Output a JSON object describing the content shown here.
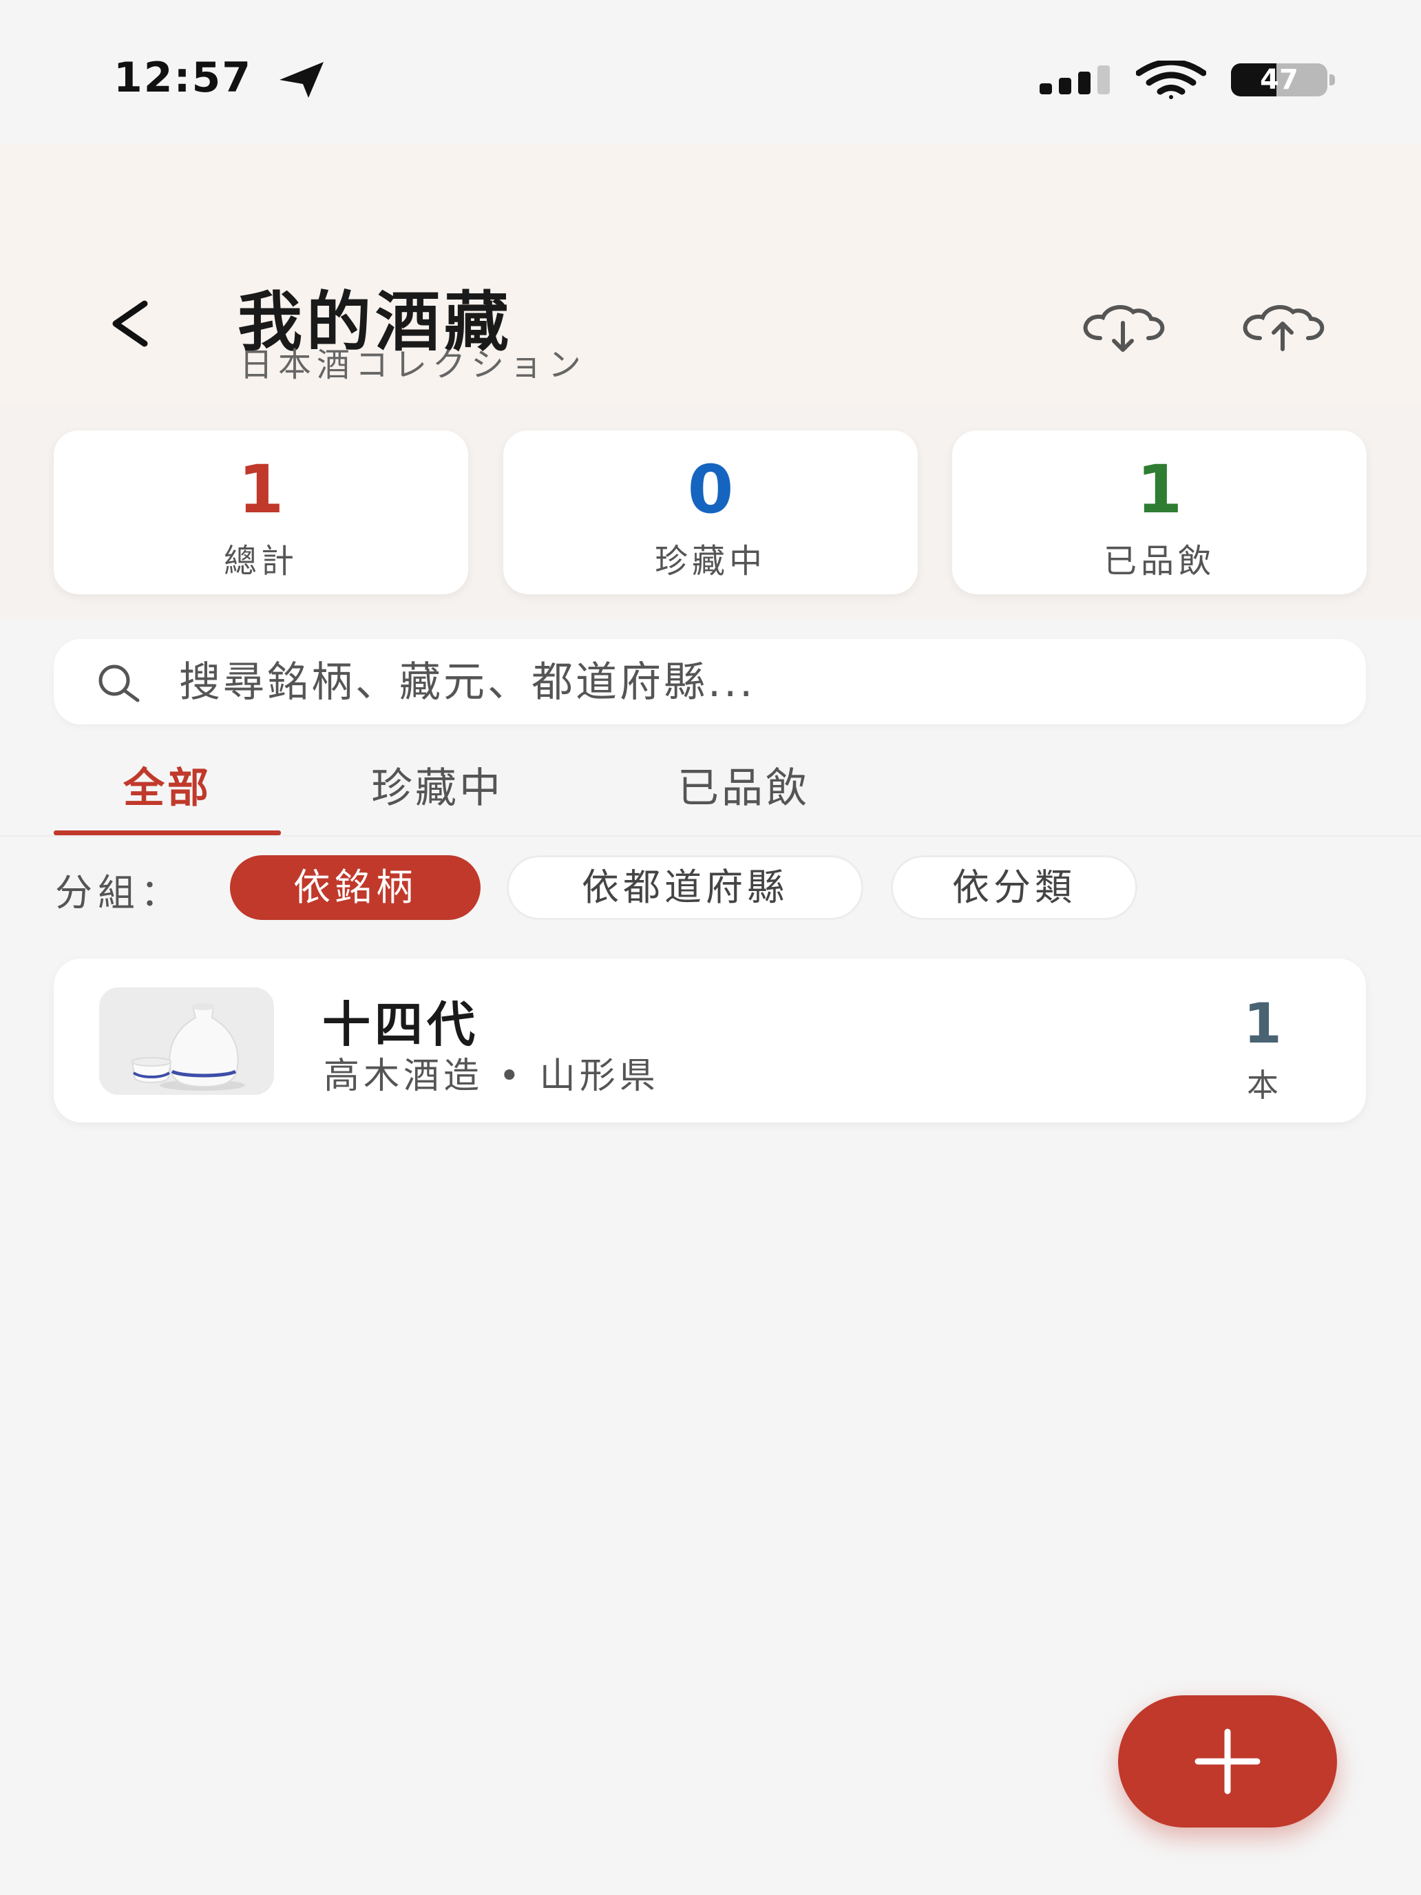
{
  "status_bar": {
    "time": "12:57",
    "battery_level": "47",
    "battery_fraction": 0.47
  },
  "header": {
    "title": "我的酒藏",
    "subtitle": "日本酒コレクション",
    "icons": [
      "back-chevron-icon",
      "cloud-download-icon",
      "cloud-upload-icon"
    ]
  },
  "summary": [
    {
      "value": "1",
      "label": "總計",
      "color": "#c0392b"
    },
    {
      "value": "0",
      "label": "珍藏中",
      "color": "#1565c0"
    },
    {
      "value": "1",
      "label": "已品飲",
      "color": "#2e7d32"
    }
  ],
  "search": {
    "placeholder": "搜尋銘柄、藏元、都道府縣..."
  },
  "tabs": [
    {
      "label": "全部",
      "active": true
    },
    {
      "label": "珍藏中",
      "active": false
    },
    {
      "label": "已品飲",
      "active": false
    }
  ],
  "group": {
    "label": "分組：",
    "options": [
      {
        "label": "依銘柄",
        "active": true
      },
      {
        "label": "依都道府縣",
        "active": false
      },
      {
        "label": "依分類",
        "active": false
      }
    ]
  },
  "items": [
    {
      "name": "十四代",
      "meta": "高木酒造 • 山形県",
      "count": "1",
      "unit": "本",
      "thumbnail_icon": "sake-tokkuri-icon"
    }
  ],
  "fab": {
    "icon": "plus-icon"
  },
  "colors": {
    "accent": "#c0392b",
    "background": "#f5f5f5",
    "header_background": "#f8f3ef"
  }
}
